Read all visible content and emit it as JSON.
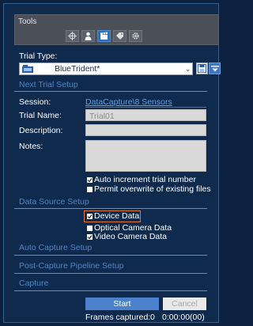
{
  "tools": {
    "title": "Tools",
    "icons": [
      "target-icon",
      "person-icon",
      "clapperboard-icon",
      "tag-icon",
      "gear-icon"
    ],
    "active_icon": "clapperboard-icon"
  },
  "trial_type": {
    "label": "Trial Type:",
    "selected": "BlueTrident*"
  },
  "next_trial_setup": {
    "heading": "Next Trial Setup",
    "session_label": "Session:",
    "session_value": "DataCapture\\8 Sensors",
    "trial_name_label": "Trial Name:",
    "trial_name_value": "Trial01",
    "description_label": "Description:",
    "description_value": "",
    "notes_label": "Notes:",
    "notes_value": "",
    "auto_increment_label": "Auto increment trial number",
    "auto_increment_checked": true,
    "permit_overwrite_label": "Permit overwrite of existing files",
    "permit_overwrite_checked": false
  },
  "data_source_setup": {
    "heading": "Data Source Setup",
    "device_data_label": "Device Data",
    "device_data_checked": true,
    "optical_camera_label": "Optical Camera Data",
    "optical_camera_checked": false,
    "video_camera_label": "Video Camera Data",
    "video_camera_checked": true
  },
  "sections": {
    "auto_capture": "Auto Capture Setup",
    "post_capture": "Post-Capture Pipeline Setup",
    "capture": "Capture"
  },
  "capture": {
    "start_label": "Start",
    "cancel_label": "Cancel",
    "frames_captured_label": "Frames captured:",
    "frames_captured_value": "0",
    "time_value": "0:00:00(00)"
  },
  "colors": {
    "background": "#0f2a4d",
    "section_heading": "#4f86c6",
    "accent": "#4a80cc",
    "highlight_border": "#e07a2e"
  }
}
